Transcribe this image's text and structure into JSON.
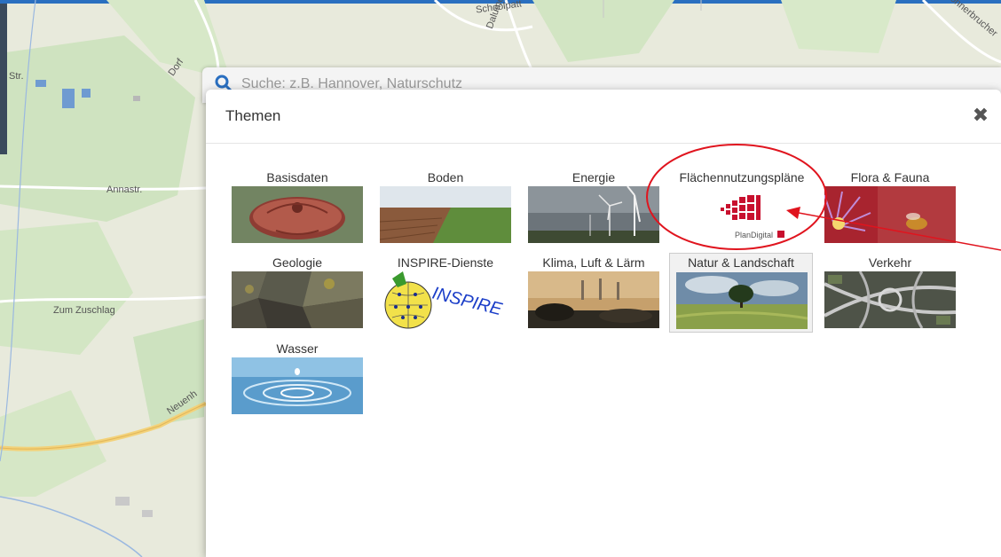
{
  "map": {
    "labels": {
      "schoolpatt": "Schoolpatt",
      "dalumer": "Dalumer Allee",
      "boerbrucher": "Böhnerbrucher",
      "dorf": "Dorf",
      "annastr": "Annastr.",
      "zum_zuschlag": "Zum Zuschlag",
      "neuenh": "Neuenh",
      "str": "Str."
    }
  },
  "search": {
    "placeholder": "Suche: z.B. Hannover, Naturschutz"
  },
  "modal": {
    "title": "Themen",
    "close_icon": "close-icon",
    "tiles": [
      {
        "label": "Basisdaten",
        "image": "survey-marker-photo"
      },
      {
        "label": "Boden",
        "image": "field-photo"
      },
      {
        "label": "Energie",
        "image": "wind-turbines-photo"
      },
      {
        "label": "Flächennutzungspläne",
        "image": "plandigital-logo",
        "logo_text": "PlanDigital"
      },
      {
        "label": "Flora & Fauna",
        "image": "bee-flower-photo"
      },
      {
        "label": "Geologie",
        "image": "rock-photo"
      },
      {
        "label": "INSPIRE-Dienste",
        "image": "inspire-logo",
        "logo_text": "INSPIRE"
      },
      {
        "label": "Klima, Luft & Lärm",
        "image": "smog-landscape-photo"
      },
      {
        "label": "Natur & Landschaft",
        "image": "tree-meadow-photo",
        "selected": true
      },
      {
        "label": "Verkehr",
        "image": "highway-interchange-photo"
      },
      {
        "label": "Wasser",
        "image": "water-drop-photo"
      }
    ]
  },
  "colors": {
    "annotation": "#e0141e",
    "accent": "#2a6fc0",
    "plandigital": "#c8102e"
  }
}
